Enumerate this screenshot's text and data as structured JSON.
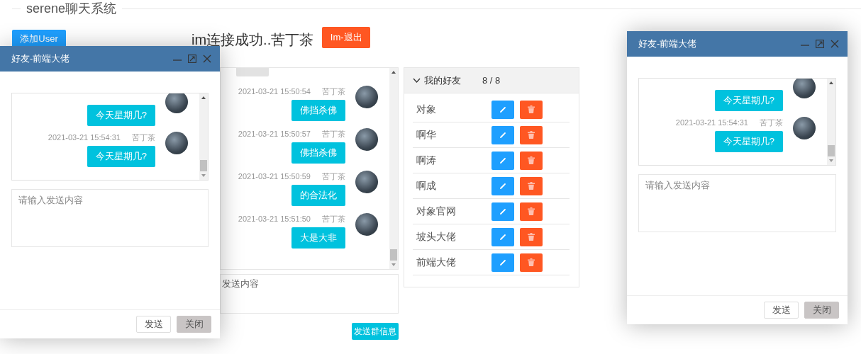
{
  "page_title": "serene聊天系统",
  "add_user_button": "添加User",
  "status_heading": "im连接成功..苦丁茶",
  "logout_button": "Im-退出",
  "group_chat": {
    "messages": [
      {
        "time": "2021-03-21 15:50:54",
        "sender": "苦丁茶",
        "text": "佛挡杀佛"
      },
      {
        "time": "2021-03-21 15:50:57",
        "sender": "苦丁茶",
        "text": "佛挡杀佛"
      },
      {
        "time": "2021-03-21 15:50:59",
        "sender": "苦丁茶",
        "text": "的合法化"
      },
      {
        "time": "2021-03-21 15:51:50",
        "sender": "苦丁茶",
        "text": "大是大非"
      }
    ],
    "input_placeholder": "发送内容",
    "send_button": "发送群信息"
  },
  "friends": {
    "group_label": "我的好友",
    "count": "8 / 8",
    "expanded": true,
    "items": [
      {
        "name": "对象"
      },
      {
        "name": "啊华"
      },
      {
        "name": "啊涛"
      },
      {
        "name": "啊成"
      },
      {
        "name": "对象官网"
      },
      {
        "name": "坡头大佬"
      },
      {
        "name": "前端大佬"
      }
    ]
  },
  "dialogs": [
    {
      "title": "好友-前端大佬",
      "messages": [
        {
          "text": "今天星期几?"
        },
        {
          "time": "2021-03-21 15:54:31",
          "sender": "苦丁茶",
          "text": "今天星期几?"
        }
      ],
      "input_placeholder": "请输入发送内容",
      "buttons": [
        {
          "label": "发送",
          "kind": "default"
        },
        {
          "label": "关闭",
          "kind": "muted"
        }
      ]
    },
    {
      "title": "好友-前端大佬",
      "messages": [
        {
          "text": "今天星期几?"
        },
        {
          "time": "2021-03-21 15:54:31",
          "sender": "苦丁茶",
          "text": "今天星期几?"
        }
      ],
      "input_placeholder": "请输入发送内容",
      "buttons": [
        {
          "label": "发送",
          "kind": "default"
        },
        {
          "label": "关闭",
          "kind": "muted"
        }
      ]
    }
  ]
}
